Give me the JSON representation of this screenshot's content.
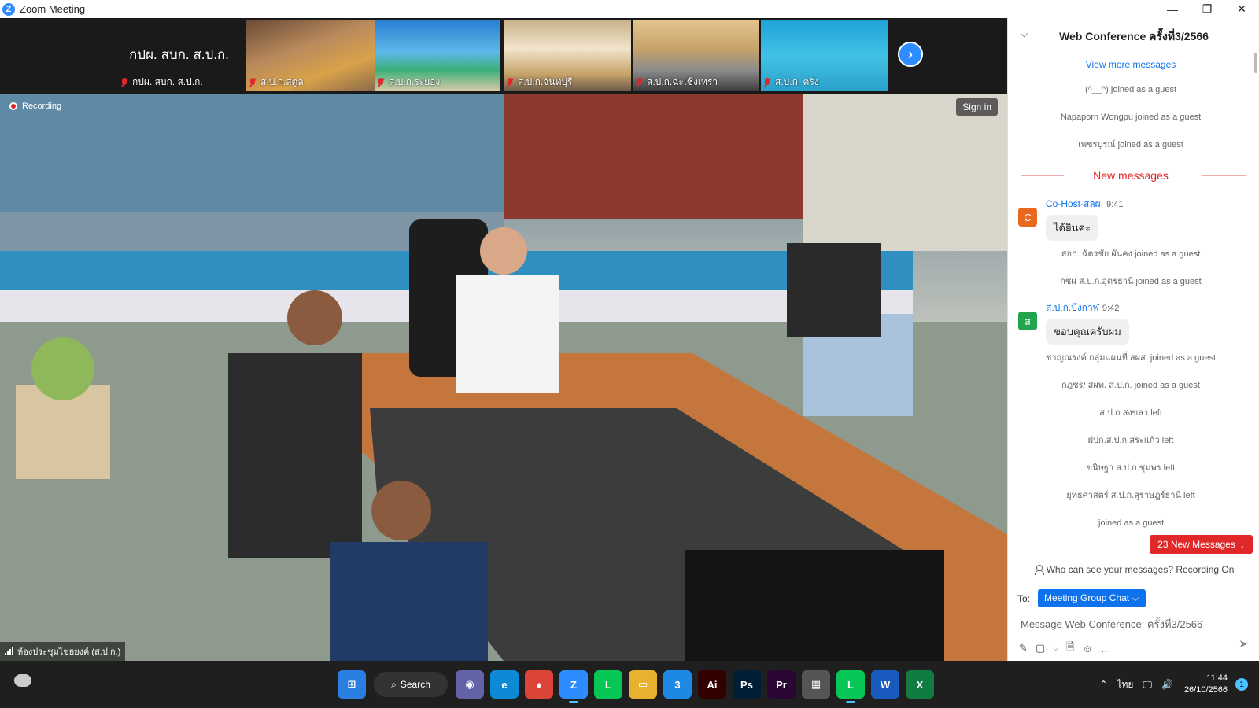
{
  "window": {
    "title": "Zoom Meeting",
    "logo": "Z",
    "minimize_icon": "minimize-icon",
    "maximize_icon": "maximize-icon",
    "close_icon": "close-icon"
  },
  "strip": {
    "big_tile_label": "กปผ. สบก. ส.ป.ก.",
    "tiles": [
      {
        "label": "กปผ. สบก. ส.ป.ก."
      },
      {
        "label": "ส.ป.ก.สตูล"
      },
      {
        "label": "ส.ป.ก.ระยอง"
      },
      {
        "label": "ส.ป.ก.จันทบุรี"
      },
      {
        "label": "ส.ป.ก.ฉะเชิงเทรา"
      },
      {
        "label": "ส.ป.ก. ตรัง"
      }
    ],
    "next_icon": "chevron-right-icon"
  },
  "main_video": {
    "recording_label": "Recording",
    "sign_in_label": "Sign in",
    "room_label": "ห้องประชุมไชยยงค์ (ส.ป.ก.)"
  },
  "chat": {
    "title": "Web Conference  ครั้งที่3/2566",
    "view_more": "View more messages",
    "system_before": [
      "(^__^) joined as a guest",
      "Napaporn Wongpu joined as a guest",
      "เพชรบูรณ์ joined as a guest"
    ],
    "new_messages_divider": "New messages",
    "messages": [
      {
        "avatar": "C",
        "avatar_color": "#e8681e",
        "sender": "Co-Host-สลผ.",
        "time": "9:41",
        "text": "ได้ยินค่ะ"
      },
      {
        "avatar": "ส",
        "avatar_color": "#23a550",
        "sender": "ส.ป.ก.บึงกาฬ",
        "time": "9:42",
        "text": "ขอบคุณครับผม"
      }
    ],
    "system_mid": [
      "สอก. ฉัตรชัย ผันคง joined as a guest",
      "กชผ ส.ป.ก.อุดรธานี joined as a guest"
    ],
    "system_after": [
      "ชาญณรงค์ กลุ่มแผนที่ สผส. joined as a guest",
      "กฎชร/ สผท. ส.ป.ก. joined as a guest",
      "ส.ป.ก.สงขลา left",
      "ฝปก.ส.ป.ก.สระแก้ว left",
      "ขนิษฐา ส.ป.ก.ชุมพร left",
      "ยุทธศาสตร์ ส.ป.ก.สุราษฎร์ธานี left",
      ".joined as a guest"
    ],
    "new_messages_button": "23 New Messages",
    "who_can_see": "Who can see your messages? Recording On",
    "to_label": "To:",
    "to_value": "Meeting Group Chat",
    "input_placeholder": "Message Web Conference  ครั้งที่3/2566"
  },
  "taskbar": {
    "search_label": "Search",
    "apps": [
      {
        "name": "start-icon",
        "glyph": "⊞",
        "color": "#2a7de1"
      },
      {
        "name": "teams-icon",
        "glyph": "◉",
        "color": "#6264a7"
      },
      {
        "name": "edge-icon",
        "glyph": "e",
        "color": "#0c8ad6"
      },
      {
        "name": "chrome-icon",
        "glyph": "●",
        "color": "#db4437"
      },
      {
        "name": "zoom-icon",
        "glyph": "Z",
        "color": "#2d8cff"
      },
      {
        "name": "line-icon",
        "glyph": "L",
        "color": "#06c755"
      },
      {
        "name": "explorer-icon",
        "glyph": "▭",
        "color": "#e8b230"
      },
      {
        "name": "app-3-icon",
        "glyph": "3",
        "color": "#1e88e5"
      },
      {
        "name": "illustrator-icon",
        "glyph": "Ai",
        "color": "#330000"
      },
      {
        "name": "photoshop-icon",
        "glyph": "Ps",
        "color": "#001e36"
      },
      {
        "name": "premiere-icon",
        "glyph": "Pr",
        "color": "#2a0634"
      },
      {
        "name": "calculator-icon",
        "glyph": "▦",
        "color": "#555"
      },
      {
        "name": "line-2-icon",
        "glyph": "L",
        "color": "#06c755"
      },
      {
        "name": "word-icon",
        "glyph": "W",
        "color": "#185abd"
      },
      {
        "name": "excel-icon",
        "glyph": "X",
        "color": "#107c41"
      }
    ],
    "tray": {
      "language": "ไทย",
      "time": "11:44",
      "date": "26/10/2566",
      "notifications": "1"
    }
  }
}
